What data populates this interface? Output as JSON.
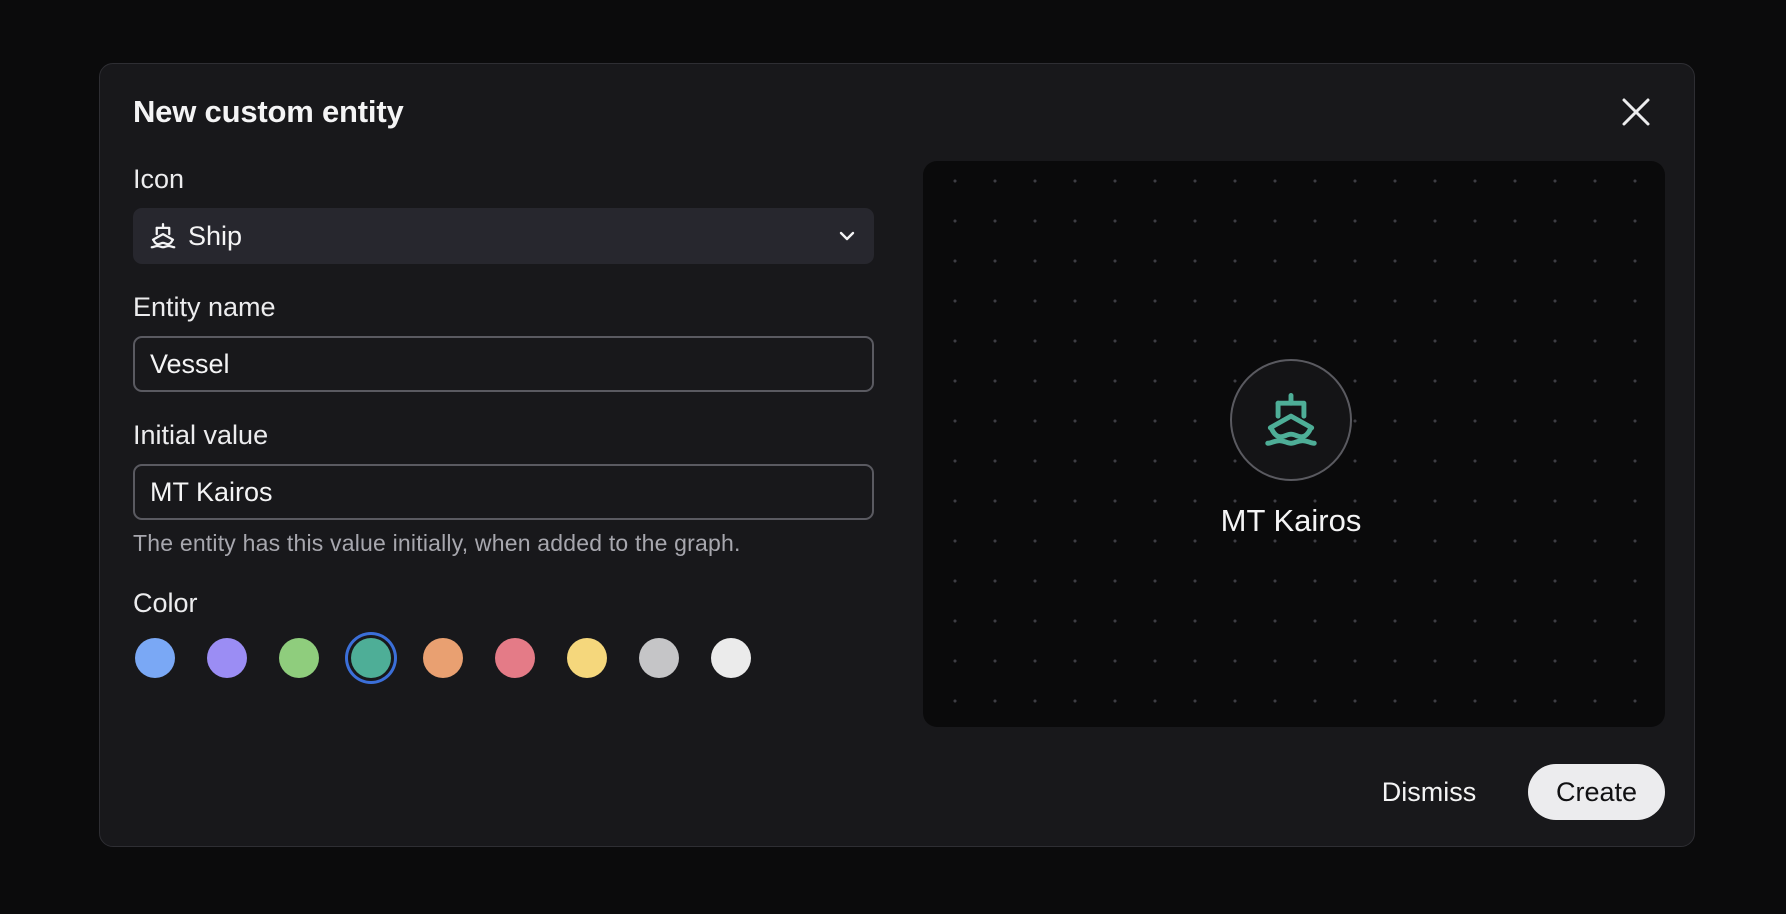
{
  "dialog": {
    "title": "New custom entity",
    "close_icon": "close-icon"
  },
  "form": {
    "icon_label": "Icon",
    "icon_select": {
      "icon": "ship-icon",
      "value": "Ship",
      "chevron": "chevron-down-icon"
    },
    "entity_name_label": "Entity name",
    "entity_name_value": "Vessel",
    "initial_value_label": "Initial value",
    "initial_value_value": "MT Kairos",
    "initial_value_help": "The entity has this value initially, when added to the graph.",
    "color_label": "Color",
    "colors": [
      {
        "name": "blue",
        "hex": "#7aa8f5",
        "selected": false
      },
      {
        "name": "purple",
        "hex": "#9b8df4",
        "selected": false
      },
      {
        "name": "green",
        "hex": "#8fcd7d",
        "selected": false
      },
      {
        "name": "teal",
        "hex": "#4eae97",
        "selected": true
      },
      {
        "name": "orange",
        "hex": "#e9a071",
        "selected": false
      },
      {
        "name": "red",
        "hex": "#e47b87",
        "selected": false
      },
      {
        "name": "yellow",
        "hex": "#f5d77c",
        "selected": false
      },
      {
        "name": "gray",
        "hex": "#c5c5c7",
        "selected": false
      },
      {
        "name": "white",
        "hex": "#ebebeb",
        "selected": false
      }
    ]
  },
  "preview": {
    "node_icon": "ship-icon",
    "node_label": "MT Kairos",
    "accent": "#4eae97"
  },
  "actions": {
    "dismiss_label": "Dismiss",
    "create_label": "Create"
  }
}
